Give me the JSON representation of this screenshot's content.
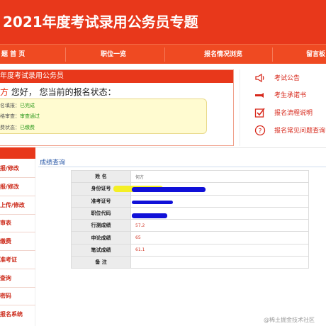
{
  "banner": {
    "title": "2021年度考试录用公务员专题"
  },
  "nav": {
    "items": [
      "题 首 页",
      "职位一览",
      "报名情况浏览",
      "留言板"
    ]
  },
  "status_panel": {
    "header": "年度考试录用公务员",
    "greeting_name": "方",
    "greeting_text": " 您好，  您当前的报名状态：",
    "rows": [
      {
        "label": "名填报：",
        "value": "已完成"
      },
      {
        "label": "格审查：",
        "value": "审查通过"
      },
      {
        "label": "费状态：",
        "value": "已缴费"
      }
    ]
  },
  "right_links": [
    {
      "icon": "announcement-icon",
      "label": "考试公告"
    },
    {
      "icon": "pledge-icon",
      "label": "考生承诺书"
    },
    {
      "icon": "checklist-icon",
      "label": "报名流程说明"
    },
    {
      "icon": "question-icon",
      "label": "报名常见问题查询"
    }
  ],
  "sidebar": {
    "items": [
      "报/修改",
      "报/修改",
      "上传/修改",
      "审表",
      "缴费",
      "准考证",
      "查询",
      "密码",
      "报名系统"
    ]
  },
  "query": {
    "title": "成绩查询",
    "rows": [
      {
        "label": "姓    名",
        "value": "何方"
      },
      {
        "label": "身份证号",
        "value": ""
      },
      {
        "label": "准考证号",
        "value": ""
      },
      {
        "label": "职位代码",
        "value": ""
      },
      {
        "label": "行测成绩",
        "value": "57.2"
      },
      {
        "label": "申论成绩",
        "value": "65"
      },
      {
        "label": "笔试成绩",
        "value": "61.1"
      },
      {
        "label": "备    注",
        "value": ""
      }
    ]
  },
  "watermark": "@稀土掘金技术社区",
  "colors": {
    "brand_red": "#e8381b",
    "link_blue": "#2b5aa8",
    "ok_green": "#2e9a1e",
    "redaction_blue": "#1010d8"
  }
}
